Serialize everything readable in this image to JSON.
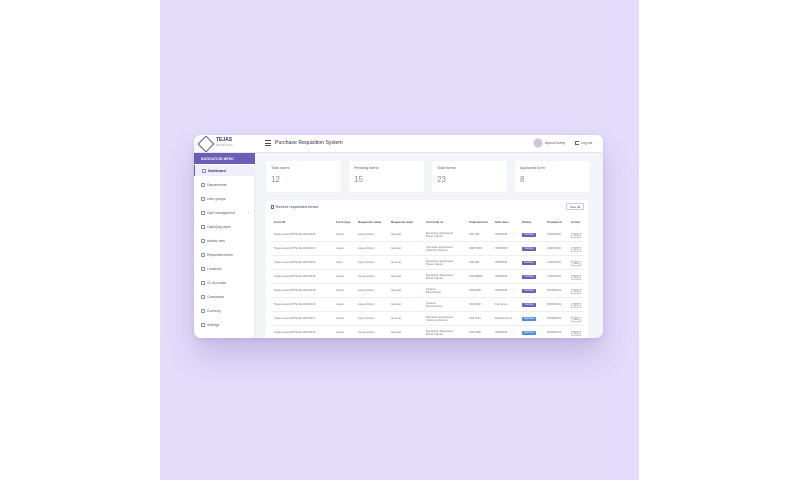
{
  "colors": {
    "background": "#e4dcfb",
    "accent": "#6a5fb4",
    "status_purple": "#6a5fb4",
    "status_blue": "#4a8fd8"
  },
  "brand": {
    "name": "TEJAS",
    "subtitle": "NETWORKS"
  },
  "header": {
    "title": "Purchase Requisition System",
    "user_name": "Apexa Dolmy",
    "logout_label": "Log out"
  },
  "sidebar": {
    "title": "NAVIGATION MENU",
    "items": [
      {
        "label": "Dashboard",
        "icon": "dashboard-icon"
      },
      {
        "label": "Departments",
        "icon": "building-icon"
      },
      {
        "label": "User groups",
        "icon": "users-icon"
      },
      {
        "label": "User management",
        "icon": "user-icon"
      },
      {
        "label": "Catch(ing users",
        "icon": "user-list-icon"
      },
      {
        "label": "Assets view",
        "icon": "asset-icon"
      },
      {
        "label": "Requested forms",
        "icon": "form-icon"
      },
      {
        "label": "Locations",
        "icon": "location-icon"
      },
      {
        "label": "GL Accounts",
        "icon": "account-icon"
      },
      {
        "label": "Companies",
        "icon": "company-icon"
      },
      {
        "label": "Currency",
        "icon": "currency-icon"
      },
      {
        "label": "Settings",
        "icon": "gear-icon"
      }
    ]
  },
  "stats": [
    {
      "label": "Total users",
      "value": "12"
    },
    {
      "label": "Pending forms",
      "value": "15"
    },
    {
      "label": "Total forms",
      "value": "23"
    },
    {
      "label": "Approved form",
      "value": "8"
    }
  ],
  "recent": {
    "title": "Recent requested forms",
    "view_all": "View all",
    "columns": [
      "Form ID",
      "Form type",
      "Requester name",
      "Requester dept",
      "Currently at",
      "Total amount",
      "Item desc",
      "Status",
      "Created at",
      "Action"
    ],
    "rows": [
      [
        "Tejas-network/PTE/19-20/116022",
        "Capex",
        "Apexa Dolmy",
        "General",
        "Reporting department\nBoxer Cajoint",
        "INR 100",
        "IN456345",
        "Pending",
        "11/08/2019",
        "View"
      ],
      [
        "Tejas-network/PTE/19-20/116021",
        "Capex",
        "Apexa Dolmy",
        "General",
        "Purchase department\nVictoria Johnston",
        "GBP 9800",
        "IN456345",
        "Pending",
        "11/08/2019",
        "View"
      ],
      [
        "Tejas-network/PTE/19-20/116020",
        "Opex",
        "Apexa Dolmy",
        "General",
        "Reporting department\nBoxer Cajoint",
        "INR 983",
        "IN456345",
        "Pending",
        "11/08/2019",
        "View"
      ],
      [
        "Tejas-network/PTE/19-20/116019",
        "Capex",
        "Apexa Dolmy",
        "General",
        "Reporting department\nBoxer Cajoint",
        "INR 86894",
        "IN456345",
        "Pending",
        "11/08/2019",
        "View"
      ],
      [
        "Tejas-network/PTE/19-20/116018",
        "Capex",
        "Apexa Dolmy",
        "General",
        "Finance\nBind Harold",
        "INR 9090",
        "IN456345",
        "Pending",
        "05/08/2019",
        "View"
      ],
      [
        "Tejas-network/PTE/19-20/116016",
        "Capex",
        "Apexa Dolmy",
        "General",
        "Finance\nFred Frances",
        "INR 1090",
        "Fire Items",
        "Pending",
        "05/08/2019",
        "View"
      ],
      [
        "Tejas-network/PTE/19-20/116017",
        "Capex",
        "Apexa Dolmy",
        "General",
        "Purchase department\nVictoria Johnston",
        "INR 1221",
        "Multiple Items",
        "Approved",
        "05/08/2019",
        "View"
      ],
      [
        "Tejas-network/PTE/19-20/116015",
        "Capex",
        "Apexa Dolmy",
        "General",
        "Reporting department\nBoxer Cajoint",
        "INR 3990",
        "IN456345",
        "Approved",
        "05/08/2019",
        "View"
      ]
    ]
  }
}
